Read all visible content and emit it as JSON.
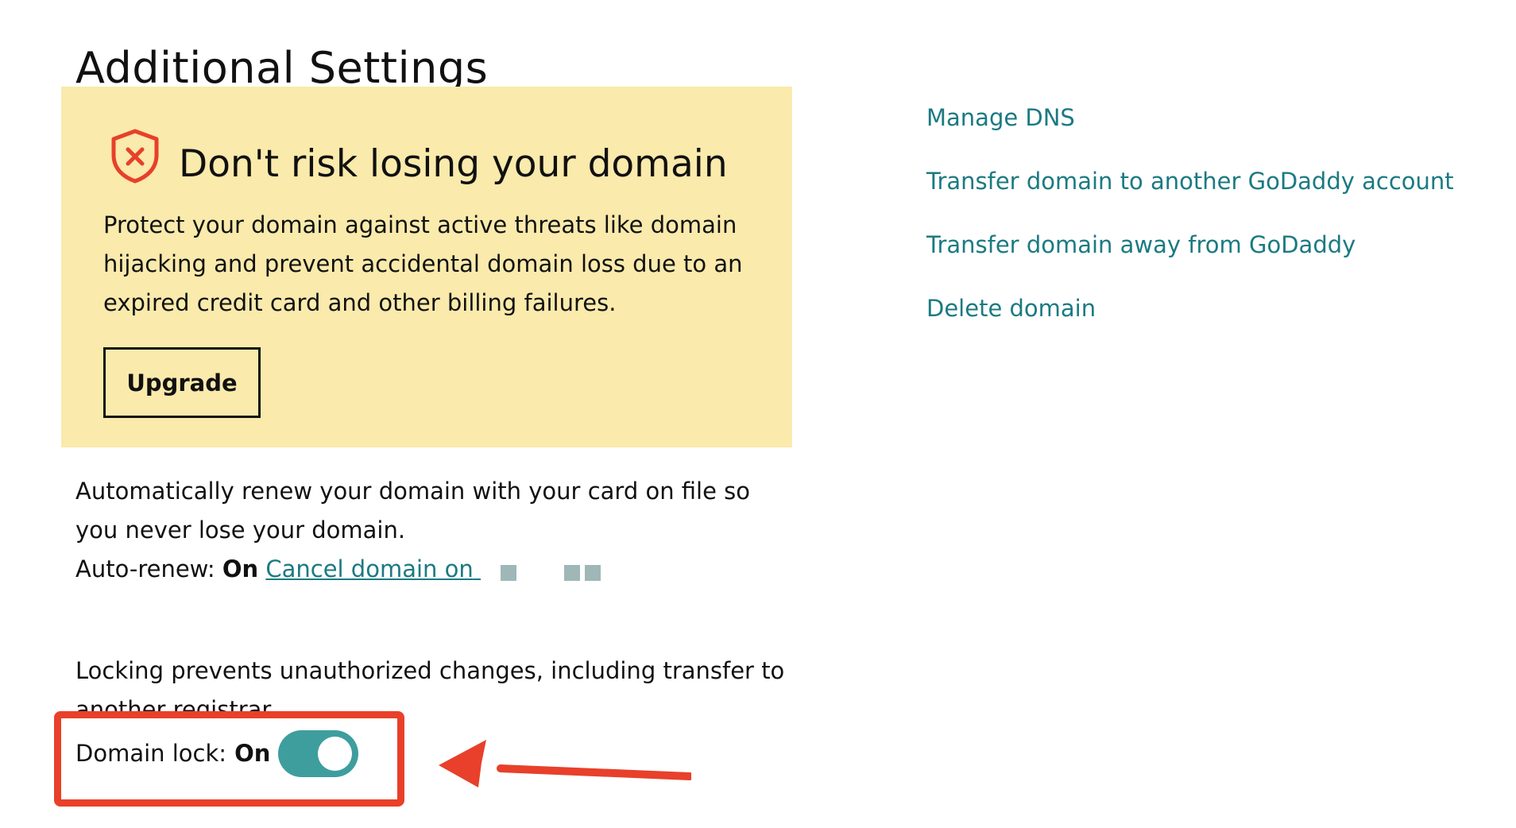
{
  "page": {
    "title": "Additional Settings"
  },
  "upsell": {
    "heading": "Don't risk losing your domain",
    "body": "Protect your domain against active threats like domain hijacking and prevent accidental domain loss due to an expired credit card and other billing failures.",
    "button_label": "Upgrade",
    "icon": "shield-x-icon"
  },
  "auto_renew": {
    "description": "Automatically renew your domain with your card on file so you never lose your domain.",
    "label": "Auto-renew:",
    "status": "On",
    "cancel_link": "Cancel domain on"
  },
  "domain_lock": {
    "description": "Locking prevents unauthorized changes, including transfer to another registrar.",
    "label": "Domain lock:",
    "status": "On",
    "toggle_on": true
  },
  "side_links": [
    {
      "label": "Manage DNS"
    },
    {
      "label": "Transfer domain to another GoDaddy account"
    },
    {
      "label": "Transfer domain away from GoDaddy"
    },
    {
      "label": "Delete domain"
    }
  ],
  "colors": {
    "link": "#1b7a82",
    "toggle": "#3e9e9e",
    "banner_bg": "#faeaac",
    "annotation": "#e8402a",
    "shield": "#e8402a"
  }
}
